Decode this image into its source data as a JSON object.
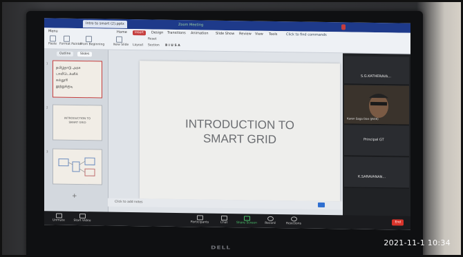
{
  "browser": {
    "tabs": [
      "Intro to smart (2).pptx",
      "Zoom Meeting"
    ],
    "badge": "Insert"
  },
  "ribbon": {
    "menus": [
      "Menu",
      "Home",
      "Insert",
      "Design",
      "Transitions",
      "Animation",
      "Slide Show",
      "Review",
      "View",
      "Tools",
      "Click to find commands"
    ],
    "tools": [
      "Paste",
      "Format Painter",
      "From Beginning",
      "New Slide",
      "Layout",
      "Reset",
      "Section"
    ]
  },
  "thumbnails": {
    "tabs": [
      "Outline",
      "Slides"
    ],
    "slides": [
      {
        "num": "1",
        "lines": [
          "தமிழ்நாடு அரசு பாலிடெக்னிக்",
          "கல்லூரி",
          "தூத்துக்குடி"
        ]
      },
      {
        "num": "2",
        "lines": [
          "INTRODUCTION TO",
          "SMART GRID"
        ]
      },
      {
        "num": "3",
        "lines": []
      }
    ],
    "add_hint": "+"
  },
  "slide": {
    "title_line1": "INTRODUCTION TO",
    "title_line2": "SMART GRID",
    "notes_placeholder": "Click to add notes"
  },
  "participants": [
    "S.G.KATHERAVA...",
    "Karen Saga Dan (JACK)",
    "Principal GT",
    "K.SARAVANAN..."
  ],
  "zoom_controls": [
    "Unmute",
    "Start Video",
    "Participants",
    "Chat",
    "Share Screen",
    "Record",
    "Reactions"
  ],
  "zoom_end": "End",
  "laptop": {
    "brand": "DELL"
  },
  "timestamp": "2021-11-1 10:34",
  "colors": {
    "zoom_blue": "#1e3a8a",
    "end_red": "#d9342b",
    "insert_red": "#c53d3d"
  }
}
